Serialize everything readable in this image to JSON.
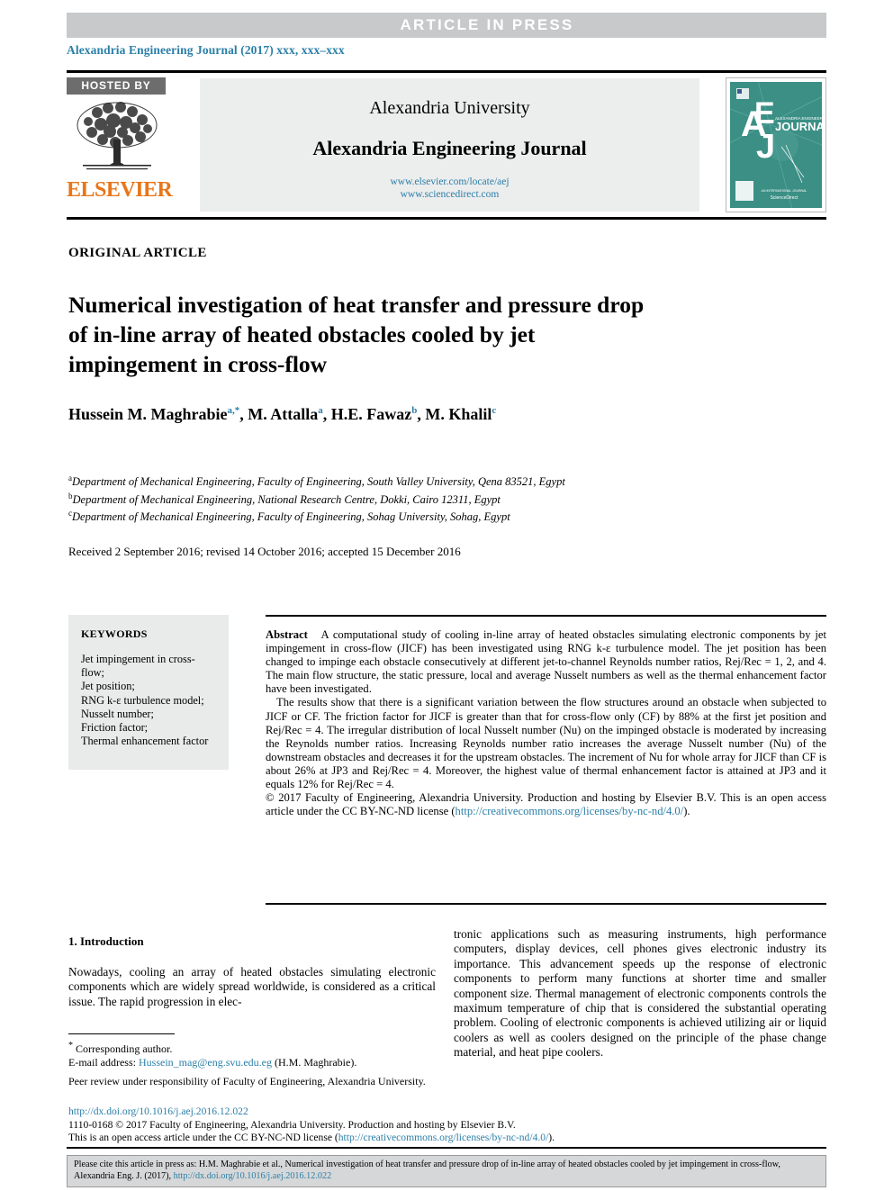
{
  "banner": {
    "text": "ARTICLE  IN  PRESS"
  },
  "journal_line": "Alexandria Engineering Journal (2017) xxx, xxx–xxx",
  "masthead": {
    "hosted_by": "HOSTED BY",
    "publisher": "ELSEVIER",
    "university": "Alexandria University",
    "journal_name": "Alexandria Engineering Journal",
    "link1": "www.elsevier.com/locate/aej",
    "link2": "www.sciencedirect.com",
    "cover_letters": "AEJ",
    "cover_word": "JOURNAL",
    "cover_small_top": "ALEXANDRIA ENGINEERING"
  },
  "article": {
    "type_label": "ORIGINAL ARTICLE",
    "title": "Numerical investigation of heat transfer and pressure drop of in-line array of heated obstacles cooled by jet impingement in cross-flow",
    "authors": [
      {
        "name": "Hussein M. Maghrabie",
        "sup": "a,*"
      },
      {
        "name": "M. Attalla",
        "sup": "a"
      },
      {
        "name": "H.E. Fawaz",
        "sup": "b"
      },
      {
        "name": "M. Khalil",
        "sup": "c"
      }
    ],
    "affiliations": [
      {
        "marker": "a",
        "text": "Department of Mechanical Engineering, Faculty of Engineering, South Valley University, Qena 83521, Egypt"
      },
      {
        "marker": "b",
        "text": "Department of Mechanical Engineering, National Research Centre, Dokki, Cairo 12311, Egypt"
      },
      {
        "marker": "c",
        "text": "Department of Mechanical Engineering, Faculty of Engineering, Sohag University, Sohag, Egypt"
      }
    ],
    "history": "Received 2 September 2016; revised 14 October 2016; accepted 15 December 2016"
  },
  "keywords": {
    "heading": "KEYWORDS",
    "items": [
      "Jet impingement in cross-flow;",
      "Jet position;",
      "RNG k-ε turbulence model;",
      "Nusselt number;",
      "Friction factor;",
      "Thermal enhancement factor"
    ]
  },
  "abstract": {
    "label": "Abstract",
    "para1": "A computational study of cooling in-line array of heated obstacles simulating electronic components by jet impingement in cross-flow (JICF) has been investigated using RNG k-ε turbulence model. The jet position has been changed to impinge each obstacle consecutively at different jet-to-channel Reynolds number ratios, Rej/Rec = 1, 2, and 4. The main flow structure, the static pressure, local and average Nusselt numbers as well as the thermal enhancement factor have been investigated.",
    "para2": "The results show that there is a significant variation between the flow structures around an obstacle when subjected to JICF or CF. The friction factor for JICF is greater than that for cross-flow only (CF) by 88% at the first jet position and Rej/Rec = 4. The irregular distribution of local Nusselt number (Nu) on the impinged obstacle is moderated by increasing the Reynolds number ratios. Increasing Reynolds number ratio increases the average Nusselt number (Nu) of the downstream obstacles and decreases it for the upstream obstacles. The increment of Nu for whole array for JICF than CF is about 26% at JP3 and Rej/Rec = 4. Moreover, the highest value of thermal enhancement factor is attained at JP3 and it equals 12% for Rej/Rec = 4.",
    "copyright": "© 2017 Faculty of Engineering, Alexandria University. Production and hosting by Elsevier B.V. This is an open access article under the CC BY-NC-ND license (",
    "license_link": "http://creativecommons.org/licenses/by-nc-nd/4.0/",
    "copyright_tail": ")."
  },
  "body": {
    "section_heading": "1. Introduction",
    "col_left": "Nowadays, cooling an array of heated obstacles simulating electronic components which are widely spread worldwide, is considered as a critical issue. The rapid progression in elec-",
    "col_right": "tronic applications such as measuring instruments, high performance computers, display devices, cell phones gives electronic industry its importance. This advancement speeds up the response of electronic components to perform many functions at shorter time and smaller component size. Thermal management of electronic components controls the maximum temperature of chip that is considered the substantial operating problem. Cooling of electronic components is achieved utilizing air or liquid coolers as well as coolers designed on the principle of the phase change material, and heat pipe coolers."
  },
  "footnotes": {
    "corresponding": "Corresponding author.",
    "email_label": "E-mail address:",
    "email": "Hussein_mag@eng.svu.edu.eg",
    "email_owner": "(H.M. Maghrabie).",
    "peer_review": "Peer review under responsibility of Faculty of Engineering, Alexandria University."
  },
  "doi_block": {
    "doi": "http://dx.doi.org/10.1016/j.aej.2016.12.022",
    "issn_line": "1110-0168 © 2017 Faculty of Engineering, Alexandria University. Production and hosting by Elsevier B.V.",
    "license_pre": "This is an open access article under the CC BY-NC-ND license (",
    "license_url": "http://creativecommons.org/licenses/by-nc-nd/4.0/",
    "license_post": ")."
  },
  "cite_box": {
    "text_pre": "Please cite this article in press as: H.M. Maghrabie et al., Numerical investigation of heat transfer and pressure drop of in-line array of heated obstacles cooled by jet impingement in cross-flow,  Alexandria Eng. J. (2017), ",
    "link": "http://dx.doi.org/10.1016/j.aej.2016.12.022"
  },
  "colors": {
    "banner_gray": "#c7c9cb",
    "link_blue": "#2b7fa8",
    "elsevier_orange": "#e8761a",
    "cover_teal": "#3b8f85",
    "keyword_bg": "#e9eaea",
    "cite_bg": "#d6d7d8"
  }
}
